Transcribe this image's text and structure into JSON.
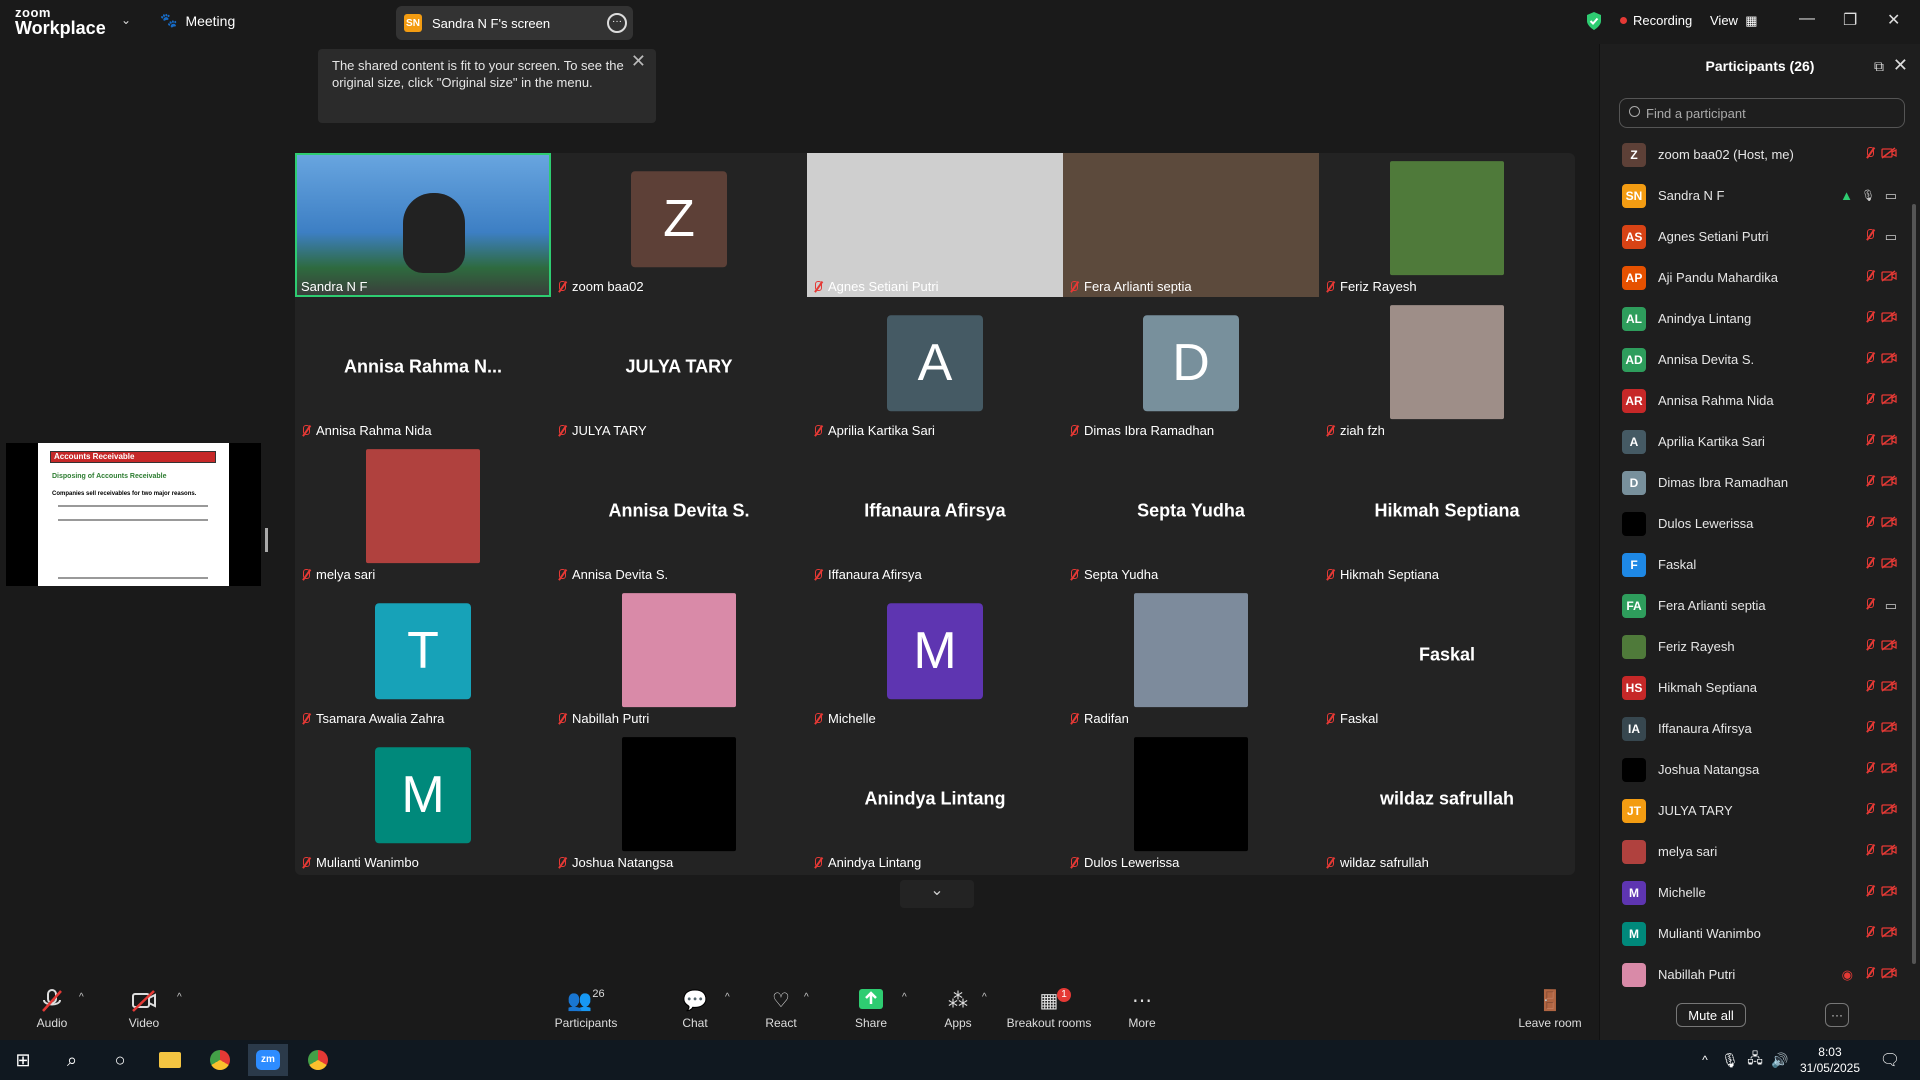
{
  "app": {
    "logo_top": "zoom",
    "logo_bottom": "Workplace",
    "meeting_label": "Meeting"
  },
  "share_pill": {
    "badge": "SN",
    "label": "Sandra N F's screen"
  },
  "status": {
    "recording": "Recording",
    "view": "View"
  },
  "toast": {
    "text": "The shared content is fit to your screen. To see the original size, click \"Original size\" in the menu."
  },
  "tiles": [
    {
      "name": "Sandra N F",
      "kind": "video",
      "bg": "#4b89c9",
      "active": true
    },
    {
      "name": "zoom baa02",
      "kind": "avatar",
      "letter": "Z",
      "color": "#5d4037"
    },
    {
      "name": "Agnes Setiani Putri",
      "kind": "video",
      "bg": "#cfcfcf"
    },
    {
      "name": "Fera Arlianti septia",
      "kind": "video",
      "bg": "#5c4a3c"
    },
    {
      "name": "Feriz Rayesh",
      "kind": "photo",
      "color": "#4f7a3a"
    },
    {
      "name": "Annisa Rahma Nida",
      "kind": "text",
      "big": "Annisa  Rahma  N..."
    },
    {
      "name": "JULYA TARY",
      "kind": "text",
      "big": "JULYA TARY"
    },
    {
      "name": "Aprilia Kartika Sari",
      "kind": "avatar",
      "letter": "A",
      "color": "#455a64"
    },
    {
      "name": "Dimas Ibra Ramadhan",
      "kind": "avatar",
      "letter": "D",
      "color": "#78909c"
    },
    {
      "name": "ziah fzh",
      "kind": "photo",
      "color": "#9e8e88"
    },
    {
      "name": "melya sari",
      "kind": "photo",
      "color": "#b0413e"
    },
    {
      "name": "Annisa Devita S.",
      "kind": "text",
      "big": "Annisa Devita S."
    },
    {
      "name": "Iffanaura Afirsya",
      "kind": "text",
      "big": "Iffanaura Afirsya"
    },
    {
      "name": "Septa Yudha",
      "kind": "text",
      "big": "Septa Yudha"
    },
    {
      "name": "Hikmah Septiana",
      "kind": "text",
      "big": "Hikmah Septiana"
    },
    {
      "name": "Tsamara Awalia Zahra",
      "kind": "avatar",
      "letter": "T",
      "color": "#17a2b8"
    },
    {
      "name": "Nabillah Putri",
      "kind": "photo",
      "color": "#d98aa8"
    },
    {
      "name": "Michelle",
      "kind": "avatar",
      "letter": "M",
      "color": "#5e35b1"
    },
    {
      "name": "Radifan",
      "kind": "photo",
      "color": "#7d8b9c"
    },
    {
      "name": "Faskal",
      "kind": "text",
      "big": "Faskal"
    },
    {
      "name": "Mulianti Wanimbo",
      "kind": "avatar",
      "letter": "M",
      "color": "#00897b"
    },
    {
      "name": "Joshua Natangsa",
      "kind": "photo",
      "color": "#000000"
    },
    {
      "name": "Anindya Lintang",
      "kind": "text",
      "big": "Anindya Lintang"
    },
    {
      "name": "Dulos Lewerissa",
      "kind": "photo",
      "color": "#000000"
    },
    {
      "name": "wildaz safrullah",
      "kind": "text",
      "big": "wildaz safrullah"
    }
  ],
  "shared_slide": {
    "title": "Accounts Receivable",
    "subtitle": "Disposing of Accounts Receivable",
    "line1": "Companies sell receivables for two major reasons."
  },
  "panel": {
    "title": "Participants (26)",
    "search_placeholder": "Find a participant",
    "mute_all": "Mute all",
    "participants": [
      {
        "initials": "Z",
        "name": "zoom baa02 (Host, me)",
        "color": "#5d4037",
        "cam": "off"
      },
      {
        "initials": "SN",
        "name": "Sandra N F",
        "color": "#f39c12",
        "cam": "on",
        "sharing": true
      },
      {
        "initials": "AS",
        "name": "Agnes Setiani Putri",
        "color": "#d84315",
        "cam": "on"
      },
      {
        "initials": "AP",
        "name": "Aji Pandu Mahardika",
        "color": "#e65100",
        "cam": "off"
      },
      {
        "initials": "AL",
        "name": "Anindya Lintang",
        "color": "#2e9d5c",
        "cam": "off"
      },
      {
        "initials": "AD",
        "name": "Annisa Devita S.",
        "color": "#2e9d5c",
        "cam": "off"
      },
      {
        "initials": "AR",
        "name": "Annisa Rahma Nida",
        "color": "#c62828",
        "cam": "off"
      },
      {
        "initials": "A",
        "name": "Aprilia Kartika Sari",
        "color": "#455a64",
        "cam": "off"
      },
      {
        "initials": "D",
        "name": "Dimas Ibra Ramadhan",
        "color": "#78909c",
        "cam": "off"
      },
      {
        "initials": "",
        "name": "Dulos Lewerissa",
        "color": "#000000",
        "cam": "off"
      },
      {
        "initials": "F",
        "name": "Faskal",
        "color": "#1e88e5",
        "cam": "off"
      },
      {
        "initials": "FA",
        "name": "Fera Arlianti septia",
        "color": "#2e9d5c",
        "cam": "on"
      },
      {
        "initials": "",
        "name": "Feriz Rayesh",
        "color": "#4f7a3a",
        "cam": "off"
      },
      {
        "initials": "HS",
        "name": "Hikmah Septiana",
        "color": "#c62828",
        "cam": "off"
      },
      {
        "initials": "IA",
        "name": "Iffanaura Afirsya",
        "color": "#37474f",
        "cam": "off"
      },
      {
        "initials": "",
        "name": "Joshua Natangsa",
        "color": "#000000",
        "cam": "off"
      },
      {
        "initials": "JT",
        "name": "JULYA TARY",
        "color": "#f39c12",
        "cam": "off"
      },
      {
        "initials": "",
        "name": "melya sari",
        "color": "#b0413e",
        "cam": "off"
      },
      {
        "initials": "M",
        "name": "Michelle",
        "color": "#5e35b1",
        "cam": "off"
      },
      {
        "initials": "M",
        "name": "Mulianti Wanimbo",
        "color": "#00897b",
        "cam": "off"
      },
      {
        "initials": "",
        "name": "Nabillah Putri",
        "color": "#d98aa8",
        "cam": "off",
        "recording": true
      }
    ]
  },
  "toolbar": {
    "audio": "Audio",
    "video": "Video",
    "participants": "Participants",
    "participants_count": "26",
    "chat": "Chat",
    "react": "React",
    "share": "Share",
    "apps": "Apps",
    "breakout": "Breakout rooms",
    "breakout_badge": "1",
    "more": "More",
    "leave": "Leave room"
  },
  "taskbar": {
    "time": "8:03",
    "date": "31/05/2025"
  }
}
